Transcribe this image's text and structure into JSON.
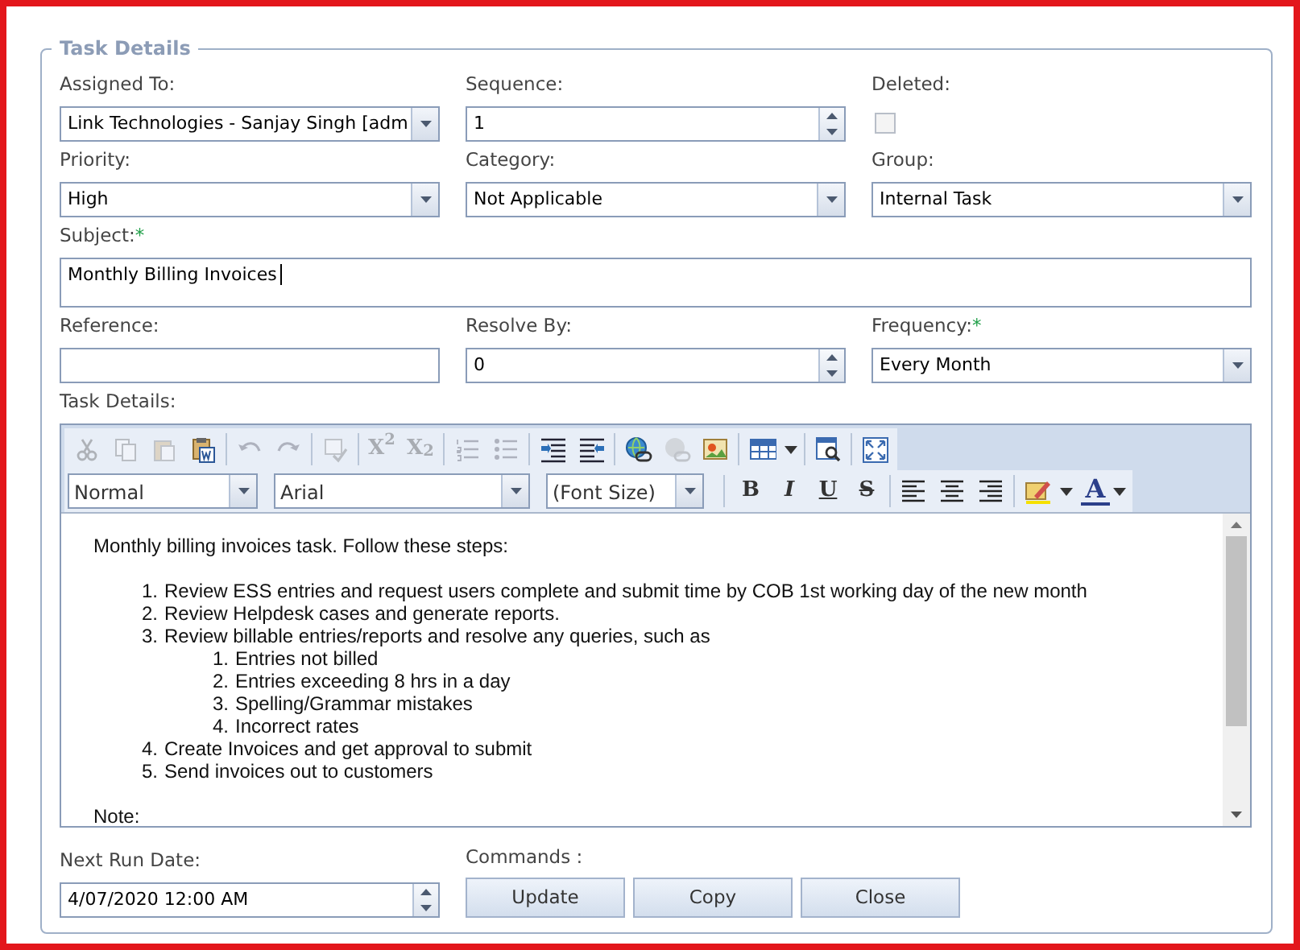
{
  "panel": {
    "title": "Task Details"
  },
  "fields": [
    {
      "label": "Assigned To:",
      "kind": "select",
      "value": "Link Technologies - Sanjay Singh [adm"
    },
    {
      "label": "Sequence:",
      "kind": "spin",
      "value": "1"
    },
    {
      "label": "Deleted:",
      "kind": "checkbox",
      "checked": false
    },
    {
      "label": "Priority:",
      "kind": "select",
      "value": "High"
    },
    {
      "label": "Category:",
      "kind": "select",
      "value": "Not Applicable"
    },
    {
      "label": "Group:",
      "kind": "select",
      "value": "Internal Task"
    },
    {
      "label": "Subject:",
      "required": "*",
      "kind": "wide",
      "value": "Monthly Billing Invoices"
    },
    {
      "label": "Reference:",
      "kind": "text"
    },
    {
      "label": "Resolve By:",
      "kind": "spin",
      "value": "0"
    },
    {
      "label": "Frequency:",
      "required": "*",
      "kind": "select",
      "value": "Every Month"
    }
  ],
  "editor": {
    "label": "Task Details:",
    "toolbar_1": [
      {
        "kind": "cut",
        "disabled": true
      },
      {
        "kind": "copy",
        "disabled": true
      },
      {
        "kind": "paste",
        "disabled": true
      },
      {
        "kind": "paste-word",
        "disabled": false
      },
      {
        "kind": "sep"
      },
      {
        "kind": "undo",
        "disabled": true
      },
      {
        "kind": "redo",
        "disabled": true
      },
      {
        "kind": "sep"
      },
      {
        "kind": "spell",
        "disabled": true
      },
      {
        "kind": "sep"
      },
      {
        "kind": "glyph",
        "text": "X$^{2}$",
        "disabled": true
      },
      {
        "kind": "glyph",
        "text": "X$_{2}$",
        "disabled": true
      },
      {
        "kind": "sep"
      },
      {
        "kind": "numbered",
        "disabled": true
      },
      {
        "kind": "bulleted",
        "disabled": true
      },
      {
        "kind": "sep"
      },
      {
        "kind": "indent",
        "disabled": false
      },
      {
        "kind": "outdent",
        "disabled": false
      },
      {
        "kind": "sep"
      },
      {
        "kind": "link",
        "disabled": false
      },
      {
        "kind": "unlink",
        "disabled": true
      },
      {
        "kind": "image",
        "disabled": false
      },
      {
        "kind": "sep"
      },
      {
        "kind": "table",
        "disabled": false
      },
      {
        "kind": "caret",
        "disabled": false
      },
      {
        "kind": "sep"
      },
      {
        "kind": "preview",
        "disabled": false
      },
      {
        "kind": "sep"
      },
      {
        "kind": "fullscreen",
        "disabled": false
      }
    ],
    "dropdowns": [
      {
        "value": "Normal"
      },
      {
        "value": "Arial"
      },
      {
        "value": "(Font Size)"
      }
    ],
    "toolbar_2": [
      {
        "kind": "glyph",
        "text": "B",
        "disabled": false
      },
      {
        "kind": "glyph",
        "text": "I",
        "disabled": false
      },
      {
        "kind": "glyph",
        "text": "U",
        "disabled": false
      },
      {
        "kind": "glyph",
        "text": "S",
        "disabled": false
      },
      {
        "kind": "sep"
      },
      {
        "kind": "align-left",
        "disabled": false
      },
      {
        "kind": "align-center",
        "disabled": false
      },
      {
        "kind": "align-right",
        "disabled": false
      },
      {
        "kind": "sep"
      },
      {
        "kind": "highlight",
        "disabled": false
      },
      {
        "kind": "caret",
        "disabled": false
      },
      {
        "kind": "glyph",
        "text": "A",
        "disabled": false
      },
      {
        "kind": "caret",
        "disabled": false
      }
    ],
    "intro": "Monthly billing invoices task. Follow these steps:",
    "steps": [
      {
        "number": "1.",
        "text": "Review ESS entries and request users complete and submit time by COB 1st working day of the new month"
      },
      {
        "number": "2.",
        "text": "Review Helpdesk cases and generate reports."
      },
      {
        "number": "3.",
        "text": "Review billable entries/reports and resolve any queries, such as",
        "children": [
          {
            "number": "1.",
            "text": "Entries not billed"
          },
          {
            "number": "2.",
            "text": "Entries exceeding 8 hrs in a day"
          },
          {
            "number": "3.",
            "text": "Spelling/Grammar mistakes"
          },
          {
            "number": "4.",
            "text": "Incorrect rates"
          }
        ]
      },
      {
        "number": "4.",
        "text": "Create Invoices and get approval to submit"
      },
      {
        "number": "5.",
        "text": "Send invoices out to customers"
      }
    ],
    "note": "Note:"
  },
  "next_run": {
    "label": "Next Run Date:",
    "value": "4/07/2020 12:00 AM"
  },
  "commands": {
    "label": "Commands :",
    "buttons": [
      "Update",
      "Copy",
      "Close"
    ]
  }
}
